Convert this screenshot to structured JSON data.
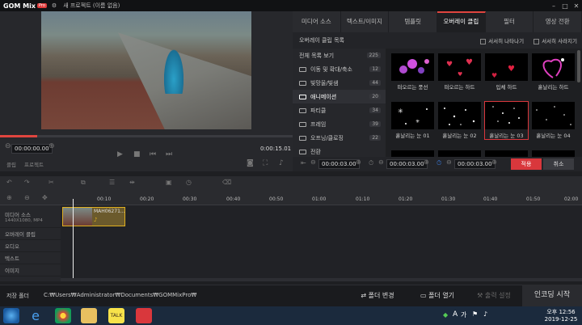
{
  "app": {
    "name": "GOM Mix",
    "badge": "Pro",
    "project_title": "새 프로젝트 (이름 없음)"
  },
  "preview": {
    "time_current": "00:00:00.00",
    "time_total": "0:00:15.01",
    "tab_clip": "클립",
    "tab_project": "프로젝트"
  },
  "tabs": [
    {
      "label": "미디어 소스"
    },
    {
      "label": "텍스트/이미지"
    },
    {
      "label": "템플릿"
    },
    {
      "label": "오버레이 클립",
      "active": true
    },
    {
      "label": "필터"
    },
    {
      "label": "영상 전환"
    }
  ],
  "panel": {
    "heading": "오버레이 클립 목록",
    "opt_fade_in": "서서히 나타나기",
    "opt_fade_out": "서서히 사라지기"
  },
  "categories": [
    {
      "label": "전체 목록 보기",
      "count": "225"
    },
    {
      "label": "이동 및 확대/축소",
      "count": "12"
    },
    {
      "label": "빛망울/빛샘",
      "count": "44"
    },
    {
      "label": "애니메이션",
      "count": "20"
    },
    {
      "label": "파티클",
      "count": "34"
    },
    {
      "label": "프레임",
      "count": "39"
    },
    {
      "label": "오프닝/클로징",
      "count": "22"
    },
    {
      "label": "전환",
      "count": ""
    }
  ],
  "clips": [
    {
      "label": "떠오르는 풍선",
      "color": "#b04ad0"
    },
    {
      "label": "떠오르는 하트",
      "color": "#e03050"
    },
    {
      "label": "입체 하트",
      "color": "#d02040"
    },
    {
      "label": "흩날리는 하트",
      "color": "#e040c0"
    },
    {
      "label": "흩날리는 눈 01",
      "color": "#ffffff"
    },
    {
      "label": "흩날리는 눈 02",
      "color": "#ffffff"
    },
    {
      "label": "흩날리는 눈 03",
      "color": "#ffffff",
      "selected": true
    },
    {
      "label": "흩날리는 눈 04",
      "color": "#ffffff"
    }
  ],
  "options": {
    "start_time": "00:00:03.00",
    "mid_time": "00:00:03.00",
    "end_time": "00:00:03.00",
    "apply": "적용",
    "cancel": "취소"
  },
  "timeline": {
    "ticks": [
      "00:10",
      "00:20",
      "00:30",
      "00:40",
      "00:50",
      "01:00",
      "01:10",
      "01:20",
      "01:30",
      "01:40",
      "01:50",
      "02:00"
    ],
    "tracks": [
      {
        "label": "미디어 소스",
        "sub": "1440X1080, MP4"
      },
      {
        "label": "오버레이 클립"
      },
      {
        "label": "오디오"
      },
      {
        "label": "텍스트"
      },
      {
        "label": "이미지"
      }
    ],
    "clip_name": "MAH06271..."
  },
  "bottom": {
    "save_folder_label": "저장 폴더",
    "save_path": "C:₩Users₩Administrator₩Documents₩GOMMixPro₩",
    "change_folder": "폴더 변경",
    "open_folder": "폴더 열기",
    "output_settings": "출력 설정",
    "encode": "인코딩 시작"
  },
  "taskbar": {
    "time": "오후 12:56",
    "date": "2019-12-25",
    "ime": "가"
  }
}
